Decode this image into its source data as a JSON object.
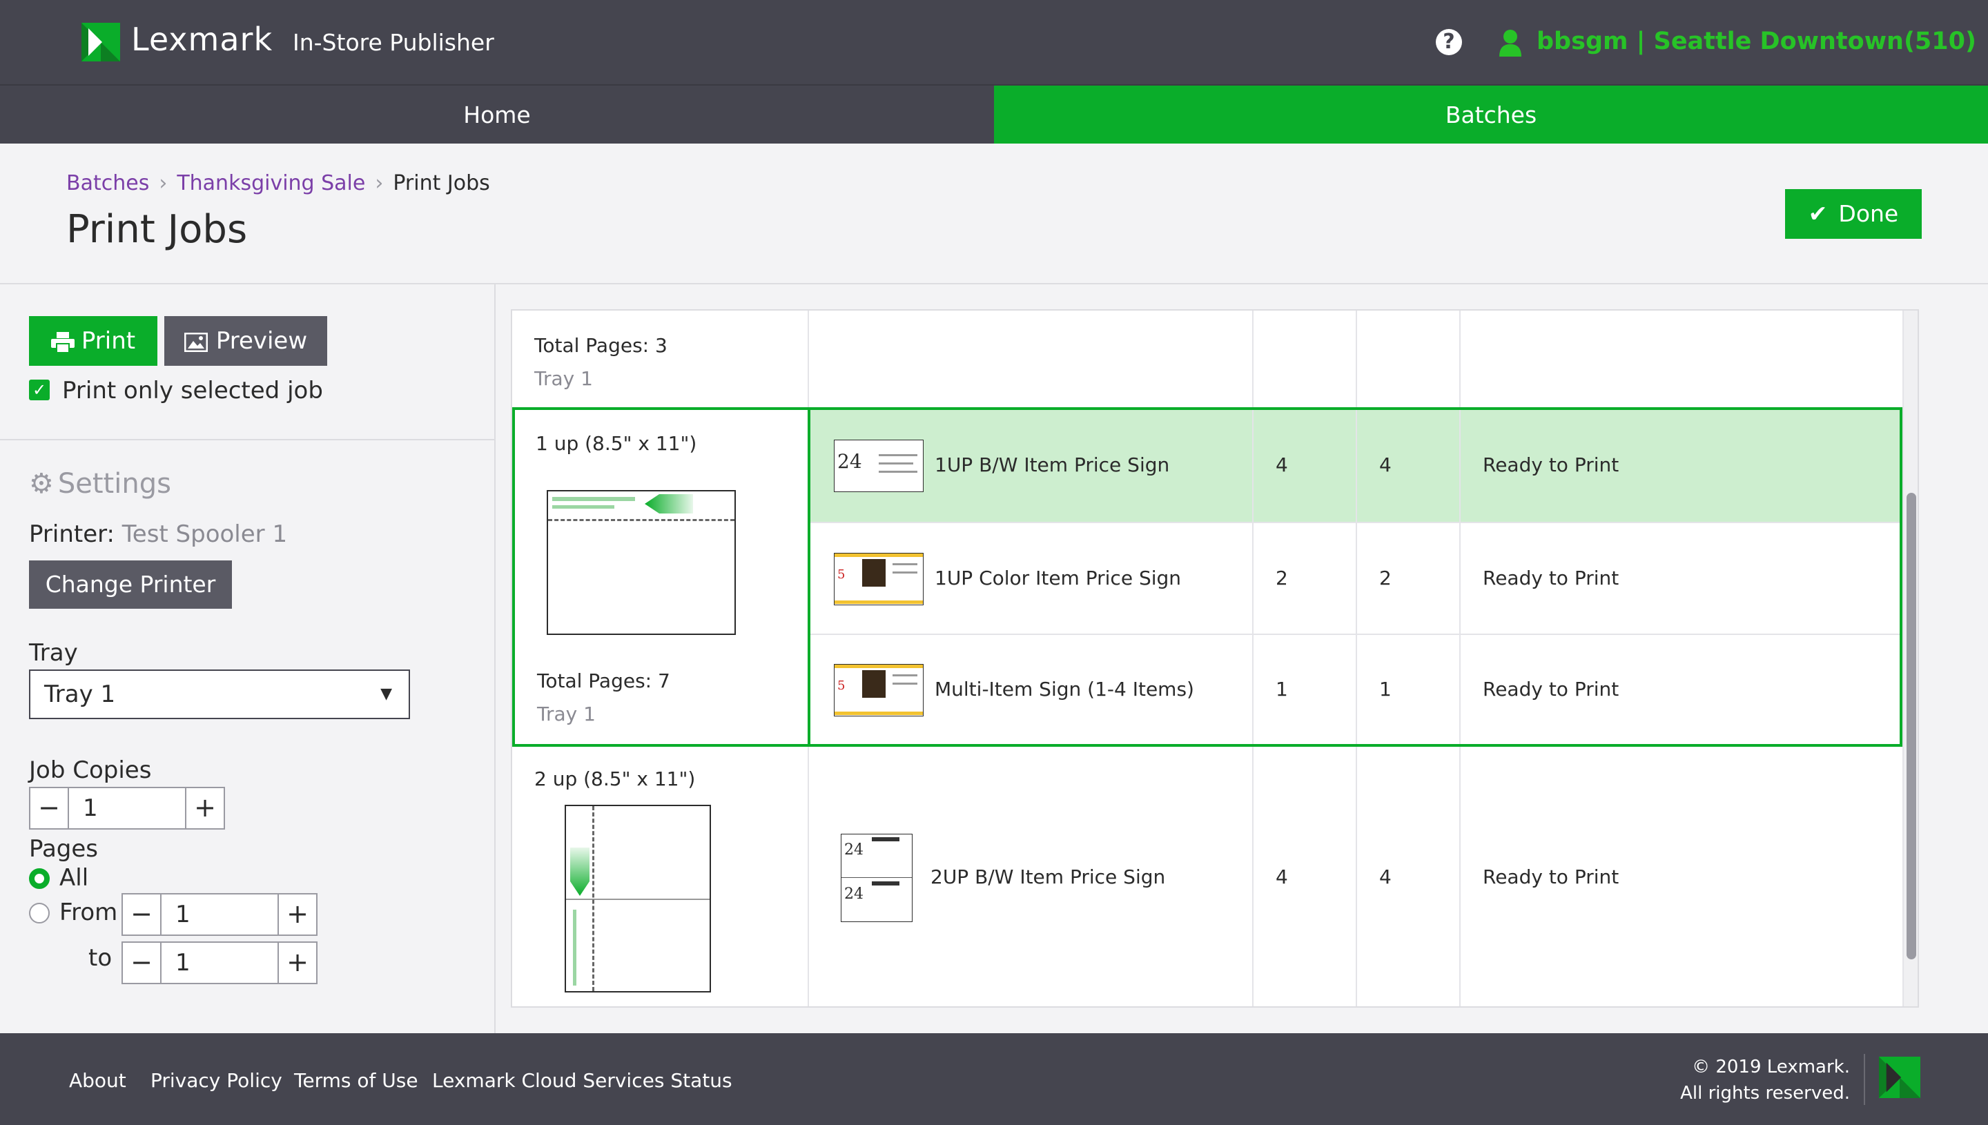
{
  "header": {
    "brand": "Lexmark",
    "product": "In-Store Publisher",
    "help_icon": "?",
    "user": "bbsgm | Seattle Downtown(510)"
  },
  "nav": {
    "home": "Home",
    "batches": "Batches"
  },
  "breadcrumb": {
    "items": [
      "Batches",
      "Thanksgiving Sale"
    ],
    "current": "Print Jobs"
  },
  "page": {
    "title": "Print Jobs",
    "done_label": "Done"
  },
  "left": {
    "print_label": "Print",
    "preview_label": "Preview",
    "selected_only_label": "Print only selected job",
    "settings_title": "Settings",
    "printer_label": "Printer:",
    "printer_value": "Test Spooler 1",
    "change_printer_label": "Change Printer",
    "tray_label": "Tray",
    "tray_value": "Tray 1",
    "copies_label": "Job Copies",
    "copies_value": "1",
    "pages_label": "Pages",
    "all_label": "All",
    "from_label": "From",
    "from_value": "1",
    "to_label": "to",
    "to_value": "1"
  },
  "table": {
    "top_group": {
      "total_pages": "Total Pages: 3",
      "tray": "Tray 1"
    },
    "group1": {
      "layout": "1 up (8.5\" x 11\")",
      "total_pages": "Total Pages: 7",
      "tray": "Tray 1"
    },
    "rows1": [
      {
        "name": "1UP B/W Item Price Sign",
        "col1": "4",
        "col2": "4",
        "status": "Ready to Print"
      },
      {
        "name": "1UP Color Item Price Sign",
        "col1": "2",
        "col2": "2",
        "status": "Ready to Print"
      },
      {
        "name": "Multi-Item Sign (1-4 Items)",
        "col1": "1",
        "col2": "1",
        "status": "Ready to Print"
      }
    ],
    "group2": {
      "layout": "2 up (8.5\" x 11\")"
    },
    "rows2": [
      {
        "name": "2UP B/W Item Price Sign",
        "col1": "4",
        "col2": "4",
        "status": "Ready to Print"
      }
    ]
  },
  "footer": {
    "links": [
      "About",
      "Privacy Policy",
      "Terms of Use",
      "Lexmark Cloud Services Status"
    ],
    "copyright_line1": "© 2019 Lexmark.",
    "copyright_line2": "All rights reserved."
  },
  "colors": {
    "accent": "#0aad2a",
    "header": "#45454f",
    "link": "#7b3fa8",
    "selected_row": "#cdeecf"
  }
}
